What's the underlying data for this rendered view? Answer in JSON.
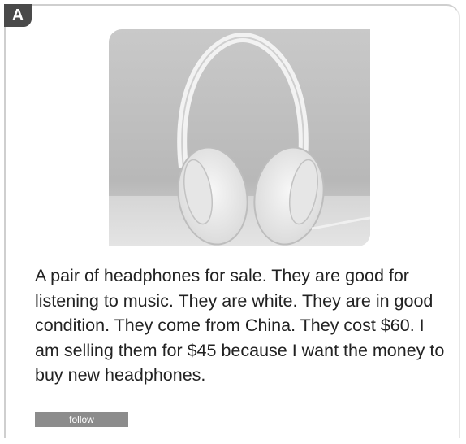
{
  "badge": {
    "label": "A"
  },
  "photo": {
    "icon": "headphones-photo"
  },
  "description": {
    "text": "A pair of headphones for sale. They are good for listening to music. They are white. They are in good condition. They come from China. They cost $60. I am selling them for $45 because I want the money to buy new headphones."
  },
  "actions": {
    "follow_label": "follow"
  },
  "colors": {
    "badge": "#4a4a4a",
    "button": "#8c8c8c",
    "border": "#cfcfcf",
    "text": "#222222"
  }
}
